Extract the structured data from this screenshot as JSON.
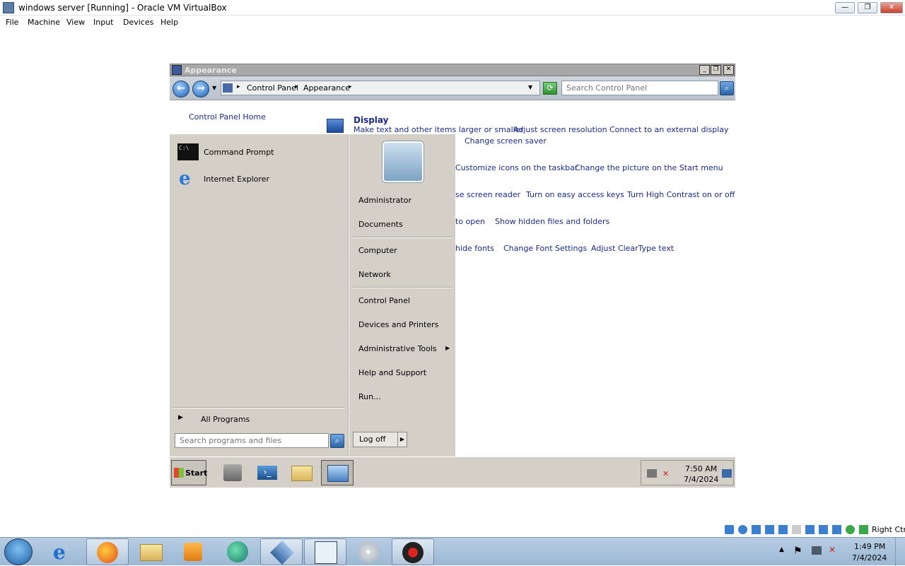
{
  "host": {
    "title": "windows server [Running] - Oracle VM VirtualBox",
    "menu": [
      "File",
      "Machine",
      "View",
      "Input",
      "Devices",
      "Help"
    ],
    "status_right_ctrl": "Right Ctrl",
    "clock_time": "1:49 PM",
    "clock_date": "7/4/2024",
    "taskbar_apps": [
      "windows-orb",
      "internet-explorer",
      "firefox",
      "file-explorer",
      "media-player",
      "app-green",
      "virtualbox",
      "windows-server-2008",
      "disc",
      "recorder"
    ]
  },
  "guest": {
    "window_title": "Appearance",
    "breadcrumb": [
      "Control Panel",
      "Appearance"
    ],
    "search_placeholder": "Search Control Panel",
    "nav_home": "Control Panel Home",
    "display": {
      "heading": "Display",
      "links": [
        "Make text and other items larger or smaller",
        "Adjust screen resolution",
        "Connect to an external display"
      ],
      "row2": "Change screen saver"
    },
    "taskbar_links": [
      "Customize icons on the taskbar",
      "Change the picture on the Start menu"
    ],
    "ease_links": [
      "se screen reader",
      "Turn on easy access keys",
      "Turn High Contrast on or off"
    ],
    "folder_links": [
      "to open",
      "Show hidden files and folders"
    ],
    "font_links": [
      "hide fonts",
      "Change Font Settings",
      "Adjust ClearType text"
    ],
    "start_menu": {
      "pinned": [
        "Command Prompt",
        "Internet Explorer"
      ],
      "all_programs": "All Programs",
      "search_placeholder": "Search programs and files",
      "right": [
        "Administrator",
        "Documents",
        "Computer",
        "Network",
        "Control Panel",
        "Devices and Printers",
        "Administrative Tools",
        "Help and Support",
        "Run..."
      ],
      "logoff": "Log off"
    },
    "start_label": "Start",
    "clock_time": "7:50 AM",
    "clock_date": "7/4/2024"
  },
  "colors": {
    "link": "#1a2a8e",
    "start_menu_bg": "#d4d0c8",
    "host_taskbar": "#a9c2dc"
  }
}
